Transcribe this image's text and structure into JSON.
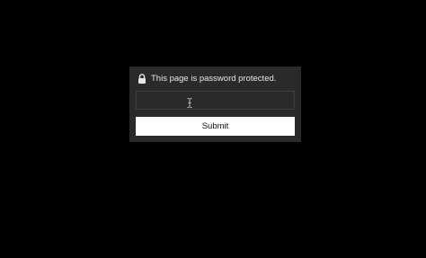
{
  "dialog": {
    "message": "This page is password protected.",
    "lock_icon": "lock-icon",
    "password_field": {
      "value": "",
      "placeholder": "",
      "type": "password"
    },
    "submit_label": "Submit"
  },
  "colors": {
    "background": "#000000",
    "panel": "#2a2a2a",
    "text": "#e6e6e6",
    "button": "#ffffff"
  }
}
